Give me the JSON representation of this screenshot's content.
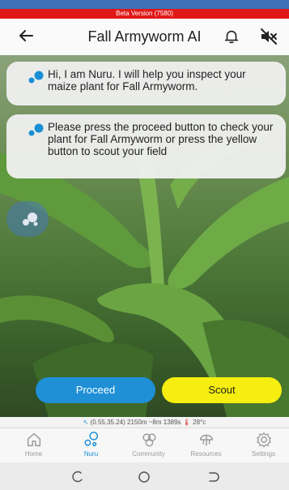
{
  "banner": {
    "text": "Beta Version (7580)"
  },
  "header": {
    "title": "Fall Armyworm AI",
    "back_icon": "arrow-left-icon",
    "bell_icon": "bell-icon",
    "mute_icon": "mute-icon"
  },
  "chat": {
    "messages": [
      "Hi, I am Nuru. I will help you inspect your maize plant for Fall Armyworm.",
      "Please press the proceed button to check your plant for Fall Armyworm or press the yellow button to scout your field"
    ]
  },
  "actions": {
    "proceed": "Proceed",
    "scout": "Scout"
  },
  "gps": {
    "coords": "(0.55,35.24)",
    "altitude": "2150m",
    "accuracy": "~8m",
    "time": "1389s",
    "temperature": "28°c"
  },
  "nav": {
    "items": [
      {
        "label": "Home",
        "icon": "home-icon"
      },
      {
        "label": "Nuru",
        "icon": "nuru-icon"
      },
      {
        "label": "Community",
        "icon": "community-icon"
      },
      {
        "label": "Resources",
        "icon": "resources-icon"
      },
      {
        "label": "Settings",
        "icon": "settings-icon"
      }
    ],
    "active": "Nuru"
  },
  "colors": {
    "beta_red": "#e11818",
    "status_blue": "#3f6fb5",
    "proceed_blue": "#1f8fd6",
    "scout_yellow": "#f5ee10"
  }
}
